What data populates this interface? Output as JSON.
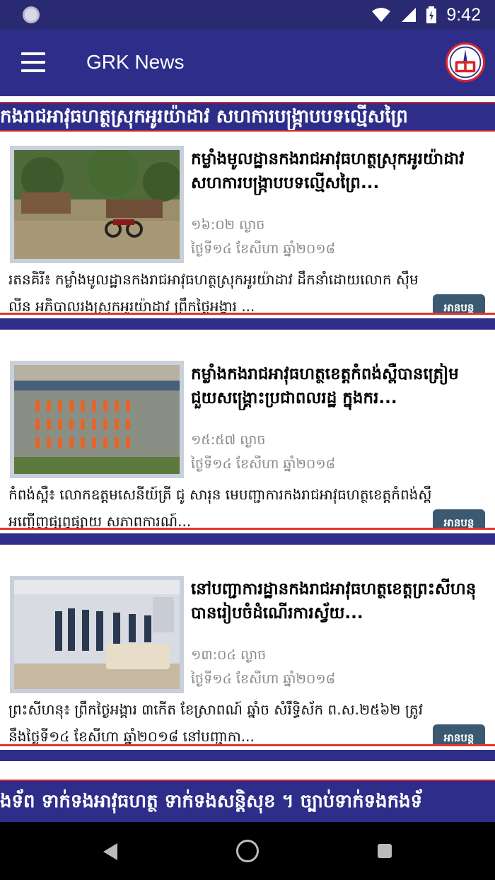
{
  "status_bar": {
    "time": "9:42"
  },
  "app_bar": {
    "title": "GRK News"
  },
  "ticker_top": {
    "text": "កងរាជអាវុធហត្ថស្រុកអូរយ៉ាដាវ សហការបង្ក្រាបបទល្មើសព្រៃ"
  },
  "articles": [
    {
      "title": "កម្លាំងមូលដ្ឋានកងរាជអាវុធហត្ថស្រុកអូរយ៉ាដាវ សហការបង្ក្រាបបទល្មើសព្រៃ...",
      "time": "១៦:០២ ល្ងាច",
      "date": "ថ្ងៃទី១៤ ខែសីហា ឆ្នាំ២០១៨",
      "excerpt": "រតនគិរី៖ កម្លាំងមូលដ្ឋានកងរាជអាវុធហត្ថស្រុកអូរយ៉ាដាវ ដឹកនាំដោយលោក ស៊ឹម លីន អភិបាលរងស្រុកអូរយ៉ាដាវ ព្រឹកថ្ងៃអង្គារ ...",
      "read_more": "អានបន្ត"
    },
    {
      "title": "កម្លាំងកងរាជអាវុធហត្ថខេត្តកំពង់ស្ពឺបានត្រៀម ជួយសង្គ្រោះប្រជាពលរដ្ឋ ក្នុងករ...",
      "time": "១៥:៥៧ ល្ងាច",
      "date": "ថ្ងៃទី១៤ ខែសីហា ឆ្នាំ២០១៨",
      "excerpt": "កំពង់ស្ពឺ៖ លោកឧត្តមសេនីយ៍ត្រី ជូ សារុន មេបញ្ជាការកងរាជអាវុធហត្ថខេត្តកំពង់ស្ពឺ អញ្ជើញផ្សព្វផ្សាយ សភាពការណ៍...",
      "read_more": "អានបន្ត"
    },
    {
      "title": "នៅបញ្ជាការដ្ឋានកងរាជអាវុធហត្ថខេត្តព្រះសីហនុ បានរៀបចំដំណើរការស្វ័យ...",
      "time": "១៣:០៤ ល្ងាច",
      "date": "ថ្ងៃទី១៤ ខែសីហា ឆ្នាំ២០១៨",
      "excerpt": "ព្រះសីហនុ៖ ព្រឹកថ្ងៃអង្គារ ៣កើត ខែស្រាពណ៍ ឆ្នាំច សំរឹទ្ធិស័ក ព.ស.២៥៦២ ត្រូវនឹងថ្ងៃទី១៤ ខែសីហា ឆ្នាំ២០១៨ នៅបញ្ជាកា...",
      "read_more": "អានបន្ត"
    }
  ],
  "ticker_bottom": {
    "text": "ងទ័ព ទាក់ទងអាវុធហត្ថ ទាក់ទងសន្តិសុខ ។ ច្បាប់ទាក់ទងកងទ័"
  }
}
